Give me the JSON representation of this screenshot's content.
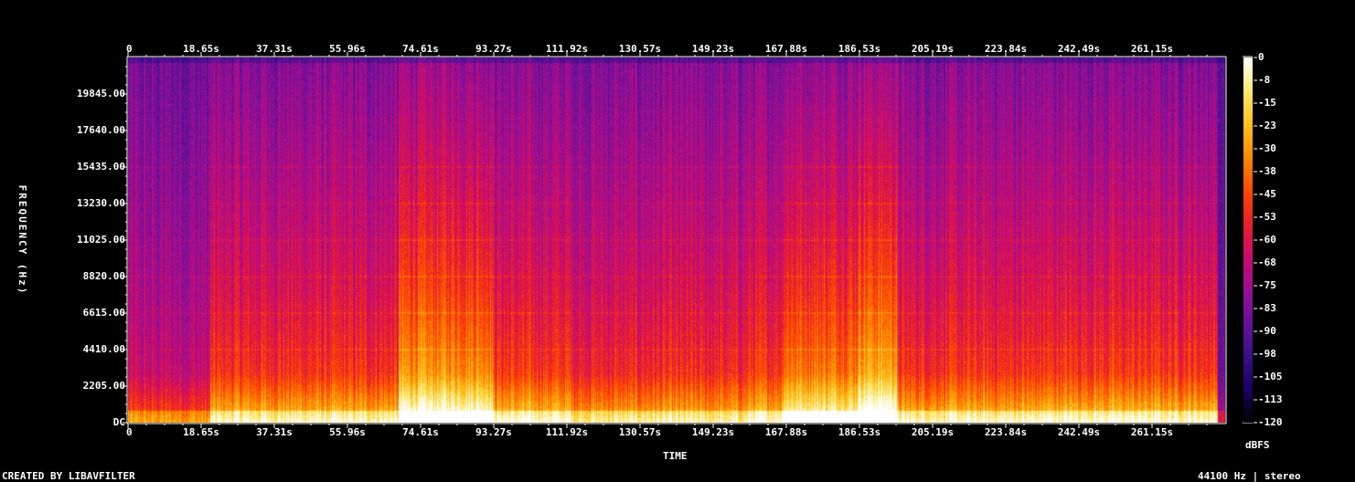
{
  "footer": {
    "left": "CREATED BY LIBAVFILTER",
    "right": "44100 Hz | stereo"
  },
  "chart_data": {
    "type": "heatmap",
    "title": "",
    "xlabel": "TIME",
    "ylabel": "FREQUENCY (Hz)",
    "colorbar_label": "dBFS",
    "x_ticks": [
      "0",
      "18.65s",
      "37.31s",
      "55.96s",
      "74.61s",
      "93.27s",
      "111.92s",
      "130.57s",
      "149.23s",
      "167.88s",
      "186.53s",
      "205.19s",
      "223.84s",
      "242.49s",
      "261.15s"
    ],
    "x_tick_values_s": [
      0,
      18.65,
      37.31,
      55.96,
      74.61,
      93.27,
      111.92,
      130.57,
      149.23,
      167.88,
      186.53,
      205.19,
      223.84,
      242.49,
      261.15
    ],
    "xlim_s": [
      0,
      279.8
    ],
    "y_ticks": [
      "DC",
      "2205.00",
      "4410.00",
      "6615.00",
      "8820.00",
      "11025.00",
      "13230.00",
      "15435.00",
      "17640.00",
      "19845.00"
    ],
    "y_tick_values_hz": [
      0,
      2205,
      4410,
      6615,
      8820,
      11025,
      13230,
      15435,
      17640,
      19845
    ],
    "ylim_hz": [
      0,
      22050
    ],
    "colorbar_ticks": [
      "0",
      "-8",
      "-15",
      "-23",
      "-30",
      "-38",
      "-45",
      "-53",
      "-60",
      "-68",
      "-75",
      "-83",
      "-90",
      "-98",
      "-105",
      "-113",
      "-120"
    ],
    "colorbar_range_dbfs": [
      -120,
      0
    ],
    "colormap": [
      "#000000",
      "#1a0060",
      "#3a1088",
      "#66119a",
      "#9a0f95",
      "#cc0b6e",
      "#ea1f2a",
      "#ff4a00",
      "#ff8a00",
      "#ffc21a",
      "#ffe970",
      "#ffffff"
    ],
    "sections": [
      {
        "start_s": 0,
        "end_s": 21,
        "level": 0.3
      },
      {
        "start_s": 21,
        "end_s": 69,
        "level": 0.5
      },
      {
        "start_s": 69,
        "end_s": 93,
        "level": 0.74
      },
      {
        "start_s": 93,
        "end_s": 113,
        "level": 0.52
      },
      {
        "start_s": 113,
        "end_s": 131,
        "level": 0.46
      },
      {
        "start_s": 131,
        "end_s": 158,
        "level": 0.47
      },
      {
        "start_s": 158,
        "end_s": 167,
        "level": 0.52
      },
      {
        "start_s": 167,
        "end_s": 186,
        "level": 0.68
      },
      {
        "start_s": 186,
        "end_s": 196,
        "level": 0.8
      },
      {
        "start_s": 196,
        "end_s": 233,
        "level": 0.5
      },
      {
        "start_s": 233,
        "end_s": 278,
        "level": 0.52
      },
      {
        "start_s": 278,
        "end_s": 280,
        "level": 0.05
      }
    ],
    "harmonic_lines_hz": [
      4410,
      6615,
      8820,
      11025,
      13230,
      15435
    ]
  }
}
